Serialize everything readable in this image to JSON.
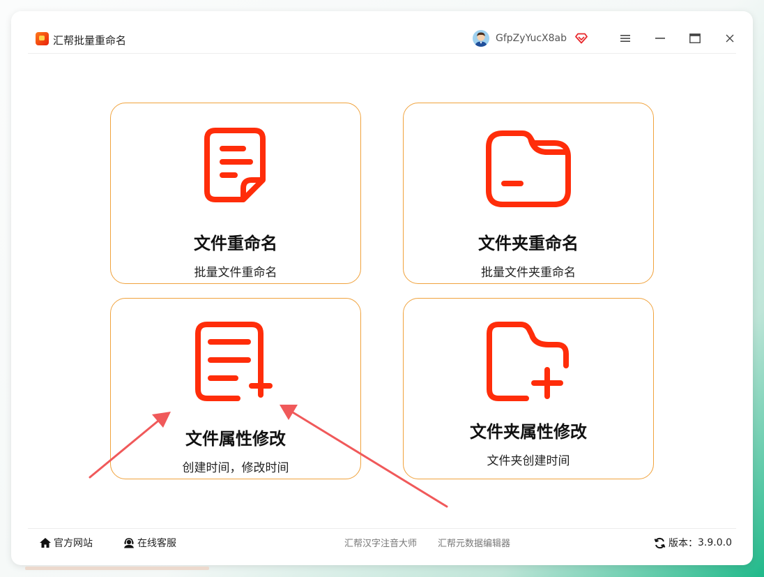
{
  "app": {
    "title": "汇帮批量重命名",
    "username": "GfpZyYucX8ab"
  },
  "cards": [
    {
      "title": "文件重命名",
      "subtitle": "批量文件重命名"
    },
    {
      "title": "文件夹重命名",
      "subtitle": "批量文件夹重命名"
    },
    {
      "title": "文件属性修改",
      "subtitle": "创建时间，修改时间"
    },
    {
      "title": "文件夹属性修改",
      "subtitle": "文件夹创建时间"
    }
  ],
  "footer": {
    "website": "官方网站",
    "support": "在线客服",
    "link1": "汇帮汉字注音大师",
    "link2": "汇帮元数据编辑器",
    "version_label": "版本：",
    "version": "3.9.0.0"
  },
  "colors": {
    "accent": "#ff2d0a",
    "card_border": "#f0a23c",
    "annotation_arrow": "#f0595a"
  },
  "icons": {
    "file": "file-rename-icon",
    "folder": "folder-rename-icon",
    "file_attr": "file-attribute-icon",
    "folder_attr": "folder-attribute-icon"
  }
}
